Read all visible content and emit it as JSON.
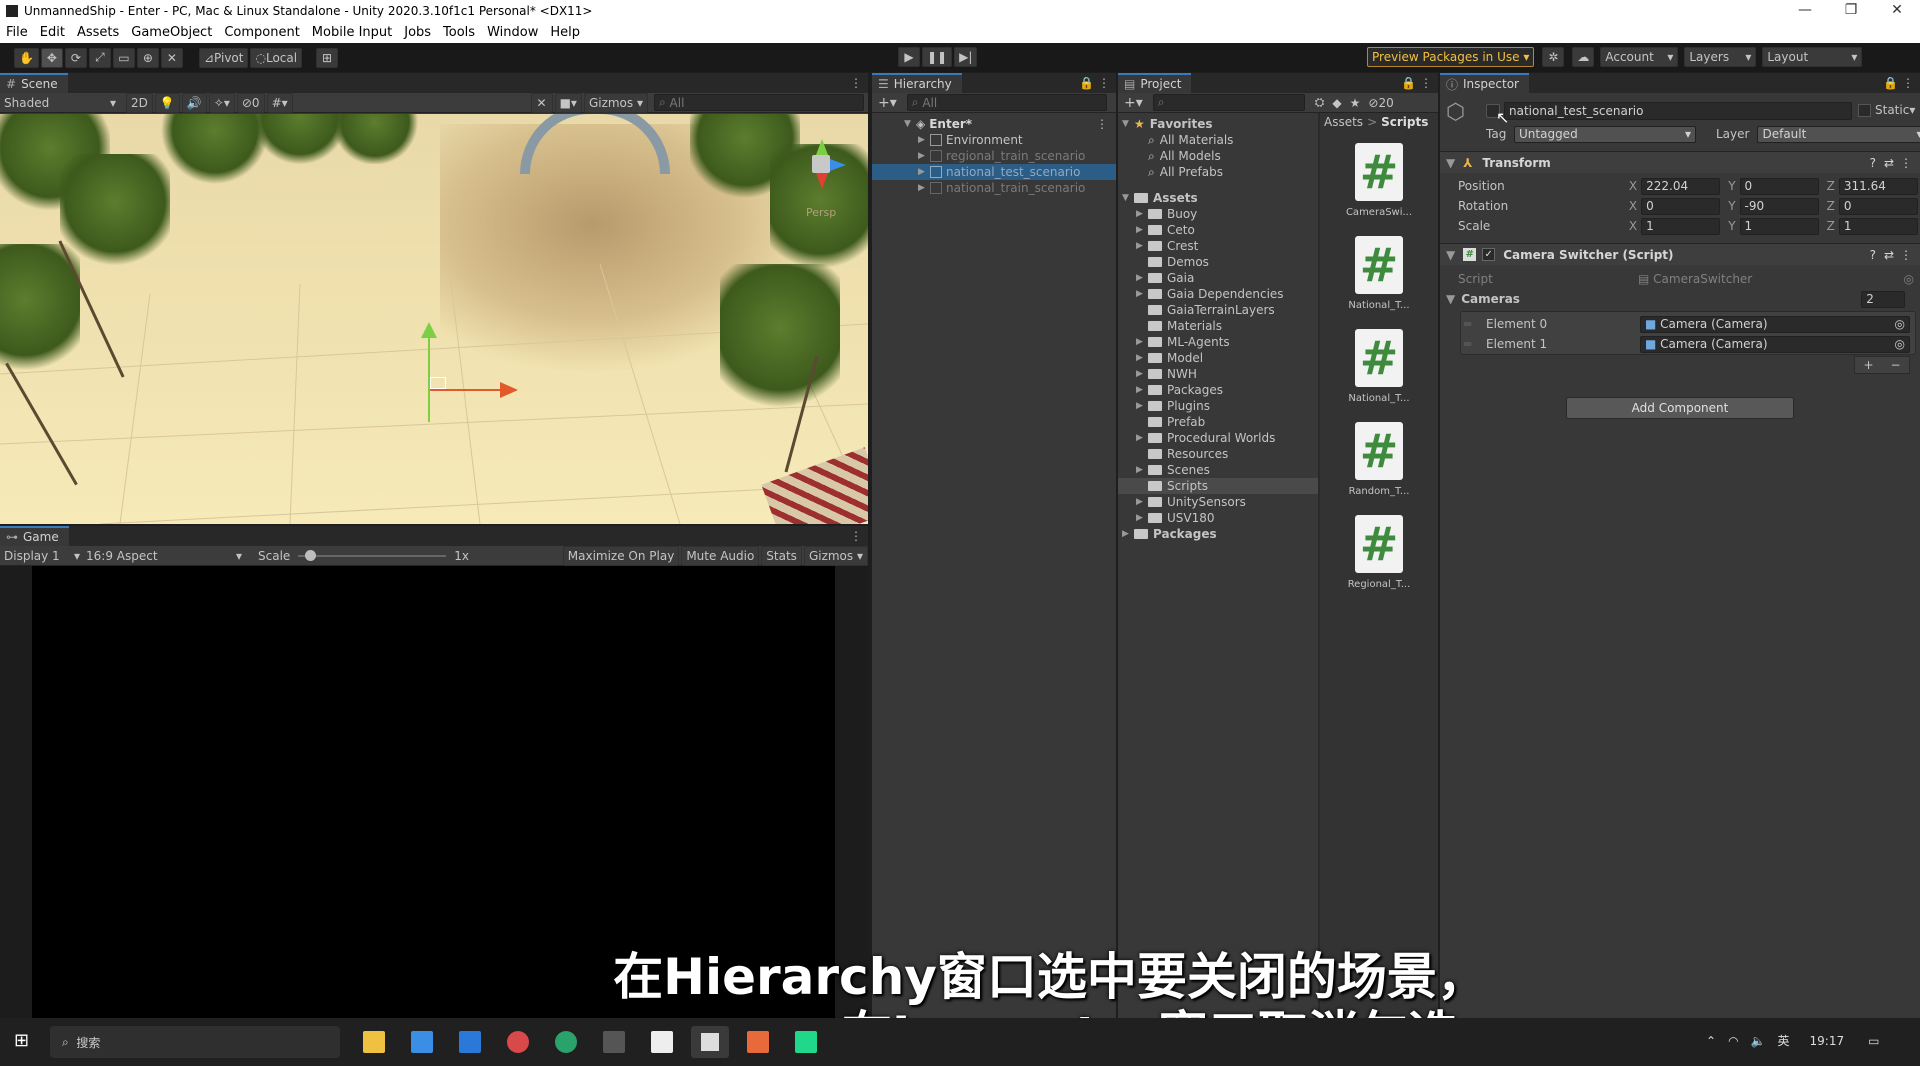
{
  "window": {
    "title": "UnmannedShip - Enter - PC, Mac & Linux Standalone - Unity 2020.3.10f1c1 Personal* <DX11>",
    "controls": [
      "—",
      "❐",
      "✕"
    ]
  },
  "menu": [
    "File",
    "Edit",
    "Assets",
    "GameObject",
    "Component",
    "Mobile Input",
    "Jobs",
    "Tools",
    "Window",
    "Help"
  ],
  "toolbar": {
    "pivot": "Pivot",
    "local": "Local",
    "preview_packages": "Preview Packages in Use",
    "account": "Account",
    "layers": "Layers",
    "layout": "Layout"
  },
  "scene": {
    "tab": "Scene",
    "shading": "Shaded",
    "mode2d": "2D",
    "hidden_count": "0",
    "gizmos": "Gizmos",
    "search_placeholder": "All",
    "persp": "Persp"
  },
  "game": {
    "tab": "Game",
    "display": "Display 1",
    "aspect": "16:9 Aspect",
    "scale_label": "Scale",
    "scale_value": "1x",
    "scale_level": 0.05,
    "maximize": "Maximize On Play",
    "mute": "Mute Audio",
    "stats": "Stats",
    "gizmos": "Gizmos"
  },
  "hierarchy": {
    "tab": "Hierarchy",
    "search_placeholder": "All",
    "root": "Enter*",
    "items": [
      {
        "label": "Environment",
        "state": "normal"
      },
      {
        "label": "regional_train_scenario",
        "state": "disabled"
      },
      {
        "label": "national_test_scenario",
        "state": "selected"
      },
      {
        "label": "national_train_scenario",
        "state": "disabled"
      }
    ]
  },
  "project": {
    "tab": "Project",
    "hidden_count": "20",
    "favorites_label": "Favorites",
    "favorites": [
      "All Materials",
      "All Models",
      "All Prefabs"
    ],
    "assets_label": "Assets",
    "folders": [
      {
        "label": "Buoy",
        "expandable": true
      },
      {
        "label": "Ceto",
        "expandable": true
      },
      {
        "label": "Crest",
        "expandable": true
      },
      {
        "label": "Demos",
        "expandable": false
      },
      {
        "label": "Gaia",
        "expandable": true
      },
      {
        "label": "Gaia Dependencies",
        "expandable": true
      },
      {
        "label": "GaiaTerrainLayers",
        "expandable": false
      },
      {
        "label": "Materials",
        "expandable": false
      },
      {
        "label": "ML-Agents",
        "expandable": true
      },
      {
        "label": "Model",
        "expandable": true
      },
      {
        "label": "NWH",
        "expandable": true
      },
      {
        "label": "Packages",
        "expandable": true
      },
      {
        "label": "Plugins",
        "expandable": true
      },
      {
        "label": "Prefab",
        "expandable": false
      },
      {
        "label": "Procedural Worlds",
        "expandable": true
      },
      {
        "label": "Resources",
        "expandable": false
      },
      {
        "label": "Scenes",
        "expandable": true
      },
      {
        "label": "Scripts",
        "expandable": false,
        "selected": true
      },
      {
        "label": "UnitySensors",
        "expandable": true
      },
      {
        "label": "USV180",
        "expandable": true
      }
    ],
    "packages_label": "Packages",
    "breadcrumb": [
      "Assets",
      ">",
      "Scripts"
    ],
    "scripts": [
      "CameraSwi...",
      "National_T...",
      "National_T...",
      "Random_T...",
      "Regional_T..."
    ]
  },
  "inspector": {
    "tab": "Inspector",
    "object_name": "national_test_scenario",
    "static_label": "Static",
    "tag_label": "Tag",
    "tag_value": "Untagged",
    "layer_label": "Layer",
    "layer_value": "Default",
    "transform": {
      "title": "Transform",
      "position_label": "Position",
      "rotation_label": "Rotation",
      "scale_label": "Scale",
      "position": {
        "x": "222.04",
        "y": "0",
        "z": "311.64"
      },
      "rotation": {
        "x": "0",
        "y": "-90",
        "z": "0"
      },
      "scale": {
        "x": "1",
        "y": "1",
        "z": "1"
      }
    },
    "camera_switcher": {
      "title": "Camera Switcher (Script)",
      "script_label": "Script",
      "script_value": "CameraSwitcher",
      "cameras_label": "Cameras",
      "cameras_count": "2",
      "elements": [
        {
          "label": "Element 0",
          "value": "Camera (Camera)"
        },
        {
          "label": "Element 1",
          "value": "Camera (Camera)"
        }
      ]
    },
    "add_component": "Add Component"
  },
  "subtitle": {
    "line1": "在Hierarchy窗口选中要关闭的场景，",
    "line2": "在Inspector窗口取消勾选"
  },
  "taskbar": {
    "search_placeholder": "搜索",
    "ime": "英",
    "time": "19:17"
  },
  "colors": {
    "selection": "#2c5d87",
    "accent_tab": "#3a79bb",
    "preview_warn": "#f0c040"
  }
}
